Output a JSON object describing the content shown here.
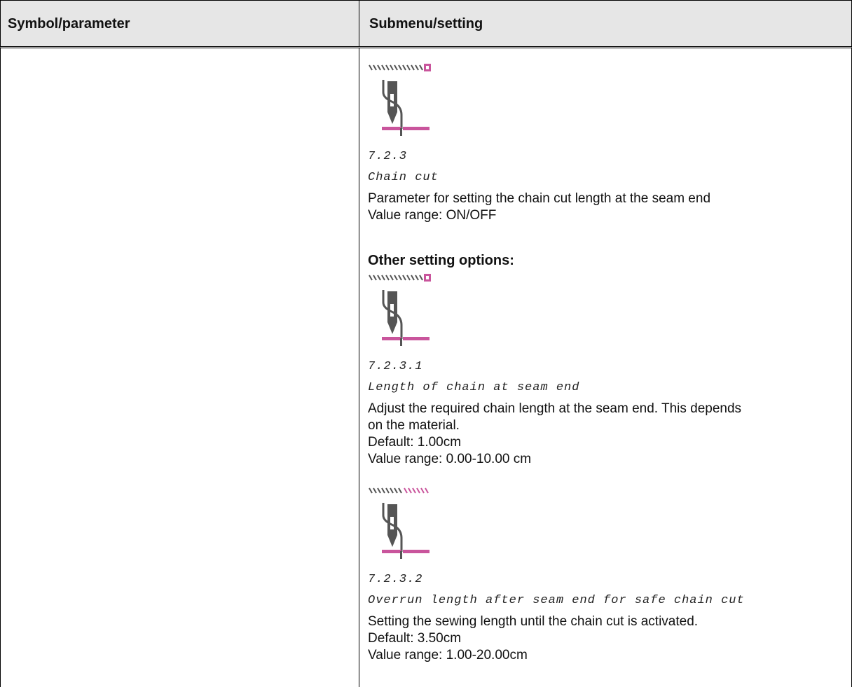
{
  "header": {
    "col1": "Symbol/parameter",
    "col2": "Submenu/setting"
  },
  "entries": [
    {
      "number": "7.2.3",
      "name": "Chain cut",
      "desc1": "Parameter for setting the chain cut length at the seam end",
      "desc2": "Value range: ON/OFF"
    },
    {
      "number": "7.2.3.1",
      "name": "Length of chain at seam end",
      "desc1": "Adjust the required chain length at the seam end. This depends",
      "desc2": "on the material.",
      "desc3": "Default: 1.00cm",
      "desc4": "Value range: 0.00-10.00 cm"
    },
    {
      "number": "7.2.3.2",
      "name": "Overrun length after seam end for safe chain cut",
      "desc1": "Setting the sewing length until the chain cut is activated.",
      "desc2": "Default: 3.50cm",
      "desc3": "Value range: 1.00-20.00cm"
    }
  ],
  "other_options": "Other setting options:",
  "colors": {
    "accent": "#c9559c",
    "icon_dark": "#555555",
    "header_bg": "#e6e6e6"
  },
  "icons": [
    "chain-cut-icon",
    "chain-length-icon",
    "overrun-length-icon"
  ]
}
